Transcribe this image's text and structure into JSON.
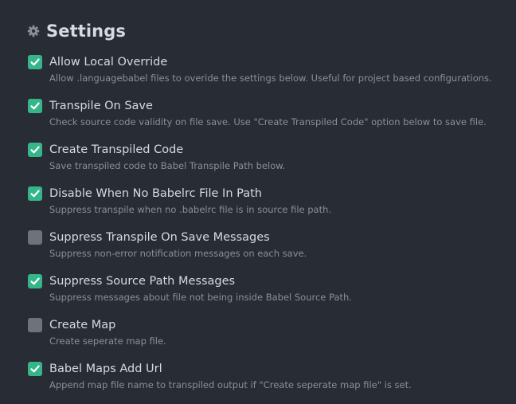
{
  "header": {
    "title": "Settings",
    "icon": "gear-icon"
  },
  "colors": {
    "background": "#282c34",
    "checkbox_on": "#35b68a",
    "checkbox_off": "#6e727c",
    "label_text": "#d7dae0",
    "description_text": "#8a8f99"
  },
  "settings": [
    {
      "label": "Allow Local Override",
      "description": "Allow .languagebabel files to overide the settings below. Useful for project based configurations.",
      "checked": true
    },
    {
      "label": "Transpile On Save",
      "description": "Check source code validity on file save. Use \"Create Transpiled Code\" option below to save file.",
      "checked": true
    },
    {
      "label": "Create Transpiled Code",
      "description": "Save transpiled code to Babel Transpile Path below.",
      "checked": true
    },
    {
      "label": "Disable When No Babelrc File In Path",
      "description": "Suppress transpile when no .babelrc file is in source file path.",
      "checked": true
    },
    {
      "label": "Suppress Transpile On Save Messages",
      "description": "Suppress non-error notification messages on each save.",
      "checked": false
    },
    {
      "label": "Suppress Source Path Messages",
      "description": "Suppress messages about file not being inside Babel Source Path.",
      "checked": true
    },
    {
      "label": "Create Map",
      "description": "Create seperate map file.",
      "checked": false
    },
    {
      "label": "Babel Maps Add Url",
      "description": "Append map file name to transpiled output if \"Create seperate map file\" is set.",
      "checked": true
    }
  ]
}
